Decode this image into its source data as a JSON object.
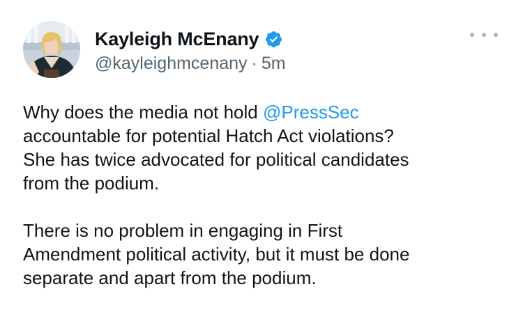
{
  "tweet": {
    "author": {
      "display_name": "Kayleigh McEnany",
      "handle": "@kayleighmcenany",
      "verified": true,
      "verified_icon": "verified-badge-icon",
      "avatar": "profile-avatar"
    },
    "separator": "·",
    "timestamp": "5m",
    "more_icon": "more-options-icon",
    "paragraph1": {
      "lead": "Why does the media not hold ",
      "mention": "@PressSec",
      "line2": "accountable for potential Hatch Act violations?",
      "line3": "She has twice advocated for political candidates",
      "line4": "from the podium."
    },
    "paragraph2": {
      "line1": "There is no problem in engaging in First",
      "line2": "Amendment political activity, but it must be done",
      "line3": "separate and apart from the podium."
    }
  },
  "colors": {
    "text": "#0f1419",
    "secondary": "#536471",
    "accent": "#1d9bf0"
  }
}
